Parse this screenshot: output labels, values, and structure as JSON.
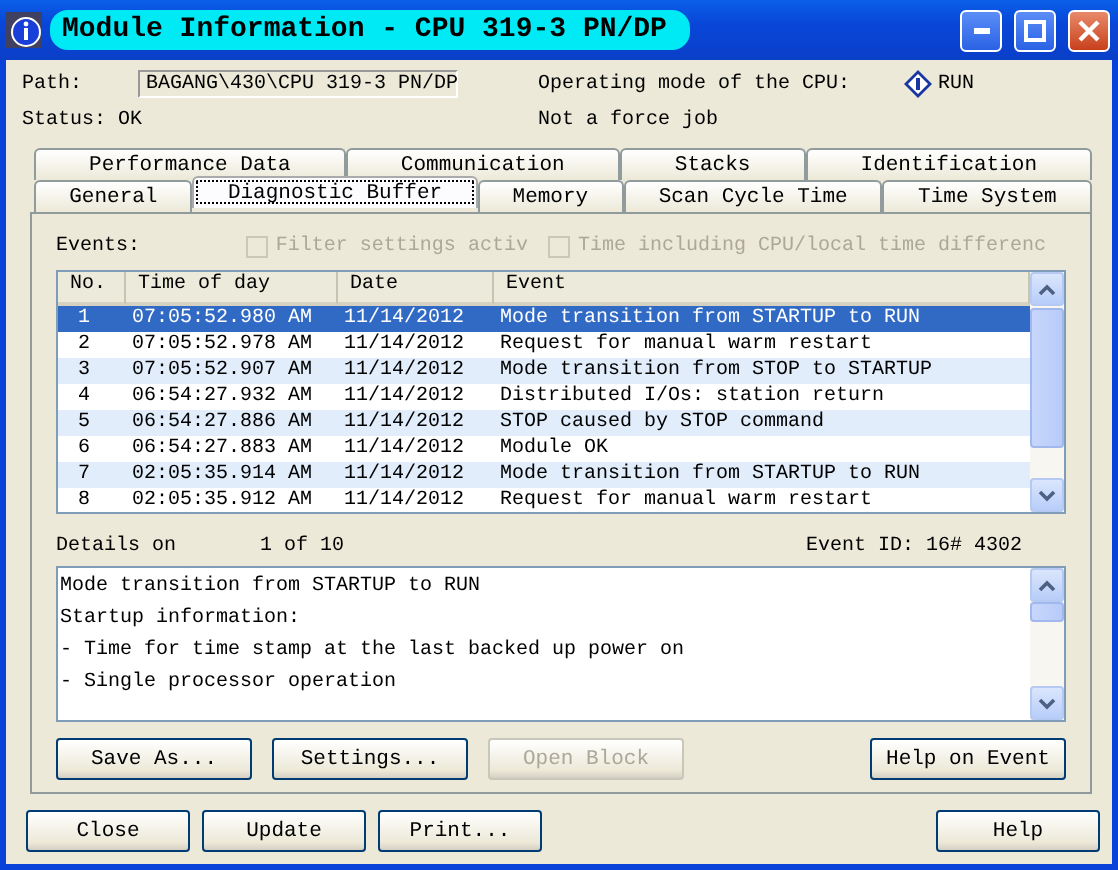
{
  "window": {
    "title": "Module Information - CPU 319-3 PN/DP"
  },
  "path": {
    "label": "Path:",
    "value": "BAGANG\\430\\CPU 319-3 PN/DP"
  },
  "operating_mode": {
    "label": "Operating mode of the  CPU:",
    "value": "RUN"
  },
  "status": "Status: OK",
  "force_job": "Not a force job",
  "tab_rows": [
    [
      {
        "label": "Performance Data",
        "selected": false
      },
      {
        "label": "Communication",
        "selected": false
      },
      {
        "label": "Stacks",
        "selected": false
      },
      {
        "label": "Identification",
        "selected": false
      }
    ],
    [
      {
        "label": "General",
        "selected": false
      },
      {
        "label": "Diagnostic Buffer",
        "selected": true
      },
      {
        "label": "Memory",
        "selected": false
      },
      {
        "label": "Scan Cycle Time",
        "selected": false
      },
      {
        "label": "Time System",
        "selected": false
      }
    ]
  ],
  "events_label": "Events:",
  "options": [
    {
      "label": "Filter settings activ",
      "checked": false,
      "disabled": true
    },
    {
      "label": "Time including CPU/local time differenc",
      "checked": false,
      "disabled": true
    }
  ],
  "table": {
    "columns": [
      "No.",
      "Time of day",
      "Date",
      "Event"
    ],
    "rows": [
      {
        "no": "1",
        "time": "07:05:52.980 AM",
        "date": "11/14/2012",
        "event": "Mode transition from STARTUP to RUN",
        "selected": true
      },
      {
        "no": "2",
        "time": "07:05:52.978 AM",
        "date": "11/14/2012",
        "event": "Request for manual warm restart",
        "selected": false
      },
      {
        "no": "3",
        "time": "07:05:52.907 AM",
        "date": "11/14/2012",
        "event": "Mode transition from STOP to STARTUP",
        "selected": false
      },
      {
        "no": "4",
        "time": "06:54:27.932 AM",
        "date": "11/14/2012",
        "event": "Distributed I/Os: station return",
        "selected": false
      },
      {
        "no": "5",
        "time": "06:54:27.886 AM",
        "date": "11/14/2012",
        "event": "STOP caused by STOP command",
        "selected": false
      },
      {
        "no": "6",
        "time": "06:54:27.883 AM",
        "date": "11/14/2012",
        "event": "Module OK",
        "selected": false
      },
      {
        "no": "7",
        "time": "02:05:35.914 AM",
        "date": "11/14/2012",
        "event": "Mode transition from STARTUP to RUN",
        "selected": false
      },
      {
        "no": "8",
        "time": "02:05:35.912 AM",
        "date": "11/14/2012",
        "event": "Request for manual warm restart",
        "selected": false
      }
    ]
  },
  "details": {
    "label": "Details on",
    "position": "1 of 10",
    "event_id": "Event ID:  16# 4302",
    "lines": [
      "Mode transition from STARTUP to RUN",
      "Startup information:",
      "- Time for time stamp at the last backed up power on",
      "- Single processor operation"
    ]
  },
  "panel_buttons": [
    {
      "label": "Save As...",
      "disabled": false
    },
    {
      "label": "Settings...",
      "disabled": false
    },
    {
      "label": "Open Block",
      "disabled": true
    },
    {
      "label": "Help on Event",
      "disabled": false
    }
  ],
  "footer_buttons": [
    "Close",
    "Update",
    "Print...",
    "Help"
  ]
}
